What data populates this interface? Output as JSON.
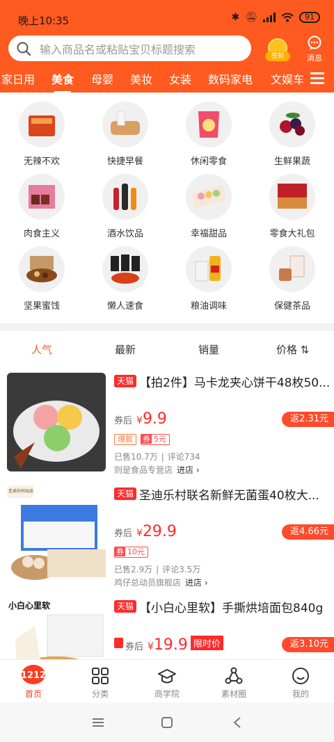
{
  "statusbar": {
    "time": "晚上10:35",
    "battery": "91"
  },
  "search": {
    "placeholder": "输入商品名或粘贴宝贝标题搜索"
  },
  "header": {
    "signin_label": "签到",
    "message_label": "消息"
  },
  "category_tabs": [
    {
      "label": "家日用"
    },
    {
      "label": "美食",
      "active": true
    },
    {
      "label": "母婴"
    },
    {
      "label": "美妆"
    },
    {
      "label": "女装"
    },
    {
      "label": "数码家电"
    },
    {
      "label": "文娱车"
    }
  ],
  "categories": [
    {
      "label": "无辣不欢",
      "icon": "spicy-snack-icon"
    },
    {
      "label": "快捷早餐",
      "icon": "bread-icon"
    },
    {
      "label": "休闲零食",
      "icon": "chips-icon"
    },
    {
      "label": "生鲜果蔬",
      "icon": "berries-icon"
    },
    {
      "label": "肉食主义",
      "icon": "meat-icon"
    },
    {
      "label": "酒水饮品",
      "icon": "drinks-icon"
    },
    {
      "label": "幸福甜品",
      "icon": "macaron-icon"
    },
    {
      "label": "零食大礼包",
      "icon": "gift-box-icon"
    },
    {
      "label": "坚果蜜饯",
      "icon": "nuts-icon"
    },
    {
      "label": "懒人速食",
      "icon": "instant-food-icon"
    },
    {
      "label": "粮油调味",
      "icon": "rice-oil-icon"
    },
    {
      "label": "保健茶品",
      "icon": "tea-icon"
    }
  ],
  "sort": [
    {
      "label": "人气",
      "active": true
    },
    {
      "label": "最新"
    },
    {
      "label": "销量"
    },
    {
      "label": "价格 ⇅"
    }
  ],
  "products": [
    {
      "platform": "天猫",
      "title": "【拍2件】马卡龙夹心饼干48枚50...",
      "coupon_after": "券后",
      "yen": "¥",
      "price": "9.9",
      "rebate": "返2.31元",
      "tag_hot": "爆款",
      "coupon_tag": "券",
      "coupon_value": "5元",
      "sold": "已售10.7万",
      "reviews": "评论734",
      "shop": "则是食品专营店",
      "enter": "进店 ›"
    },
    {
      "platform": "天猫",
      "title": "圣迪乐村联名新鲜无菌蛋40枚大...",
      "coupon_after": "券后",
      "yen": "¥",
      "price": "29.9",
      "rebate": "返4.66元",
      "coupon_tag": "券",
      "coupon_value": "10元",
      "sold": "已售2.9万",
      "reviews": "评论3.5万",
      "shop": "鸡仔总动员旗舰店",
      "enter": "进店 ›",
      "brand": "圣迪乐村出品"
    },
    {
      "platform": "天猫",
      "title": "【小白心里软】手撕烘培面包840g",
      "coupon_after": "券后",
      "yen": "¥",
      "price": "19.9",
      "limit": "限时价",
      "rebate": "返3.10元",
      "brand": "小白心里软"
    }
  ],
  "bottom_nav": [
    {
      "label": "首页",
      "active": true,
      "badge": "1212"
    },
    {
      "label": "分类"
    },
    {
      "label": "商学院"
    },
    {
      "label": "素材圈"
    },
    {
      "label": "我的"
    }
  ],
  "colors": {
    "brand": "#ff5a1f",
    "price": "#ff2a2a"
  }
}
